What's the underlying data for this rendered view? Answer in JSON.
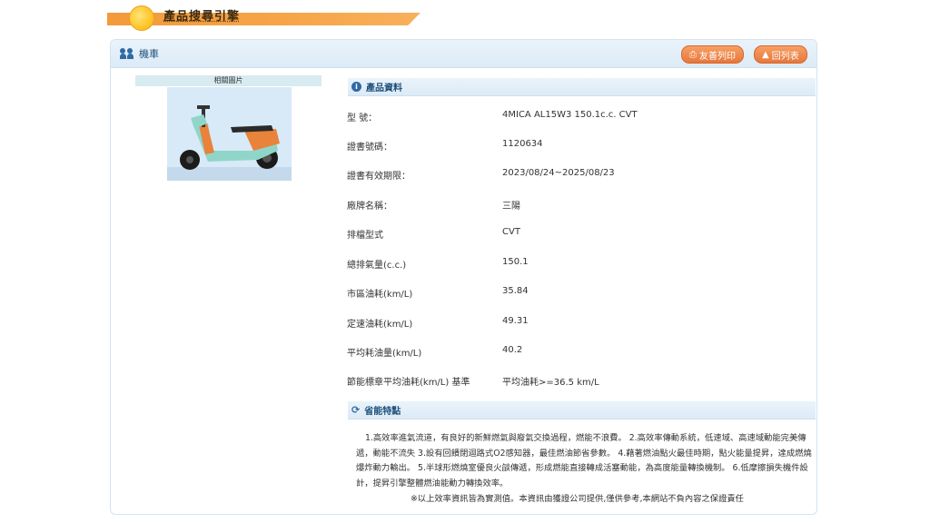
{
  "banner": {
    "title": "產品搜尋引擎"
  },
  "panel": {
    "title": "機車"
  },
  "buttons": {
    "print": "友善列印",
    "back": "回列表"
  },
  "image": {
    "label": "相關圖片"
  },
  "info": {
    "heading": "產品資料",
    "rows": [
      {
        "key": "型 號：",
        "value": "4MICA AL15W3 150.1c.c. CVT"
      },
      {
        "key": "證書號碼：",
        "value": "1120634"
      },
      {
        "key": "證書有效期限：",
        "value": "2023/08/24~2025/08/23"
      },
      {
        "key": "廠牌名稱：",
        "value": "三陽"
      },
      {
        "key": "排檔型式",
        "value": "CVT"
      },
      {
        "key": "總排氣量(c.c.)",
        "value": "150.1"
      },
      {
        "key": "市區油耗(km/L)",
        "value": "35.84"
      },
      {
        "key": "定速油耗(km/L)",
        "value": "49.31"
      },
      {
        "key": "平均耗油量(km/L)",
        "value": "40.2"
      },
      {
        "key": "節能標章平均油耗(km/L) 基準",
        "value": "平均油耗>=36.5 km/L"
      }
    ]
  },
  "eco": {
    "heading": "省能特點",
    "text": "1.高效率進氣流道，有良好的新鮮燃氣與廢氣交換過程，燃能不浪費。 2.高效率傳動系統，低速域、高速域動能完美傳遞，動能不流失 3.設有回饋閉迴路式O2感知器，最佳燃油節省參數。 4.藉著燃油點火最佳時期，點火能量提昇，達成燃燒爆炸動力輸出。 5.半球形燃燒室優良火燄傳遞，形成燃能直接轉成活塞動能，為高度能量轉換機制。 6.低摩擦損失機件設計，提昇引擎整體燃油能動力轉換效率。",
    "disclaimer": "※以上效率資訊皆為實測值。本資訊由獲證公司提供,僅供參考,本網站不負內容之保證責任"
  },
  "colors": {
    "accent": "#e8773a",
    "header_blue": "#1d4f7a",
    "banner": "#f39a3a"
  }
}
